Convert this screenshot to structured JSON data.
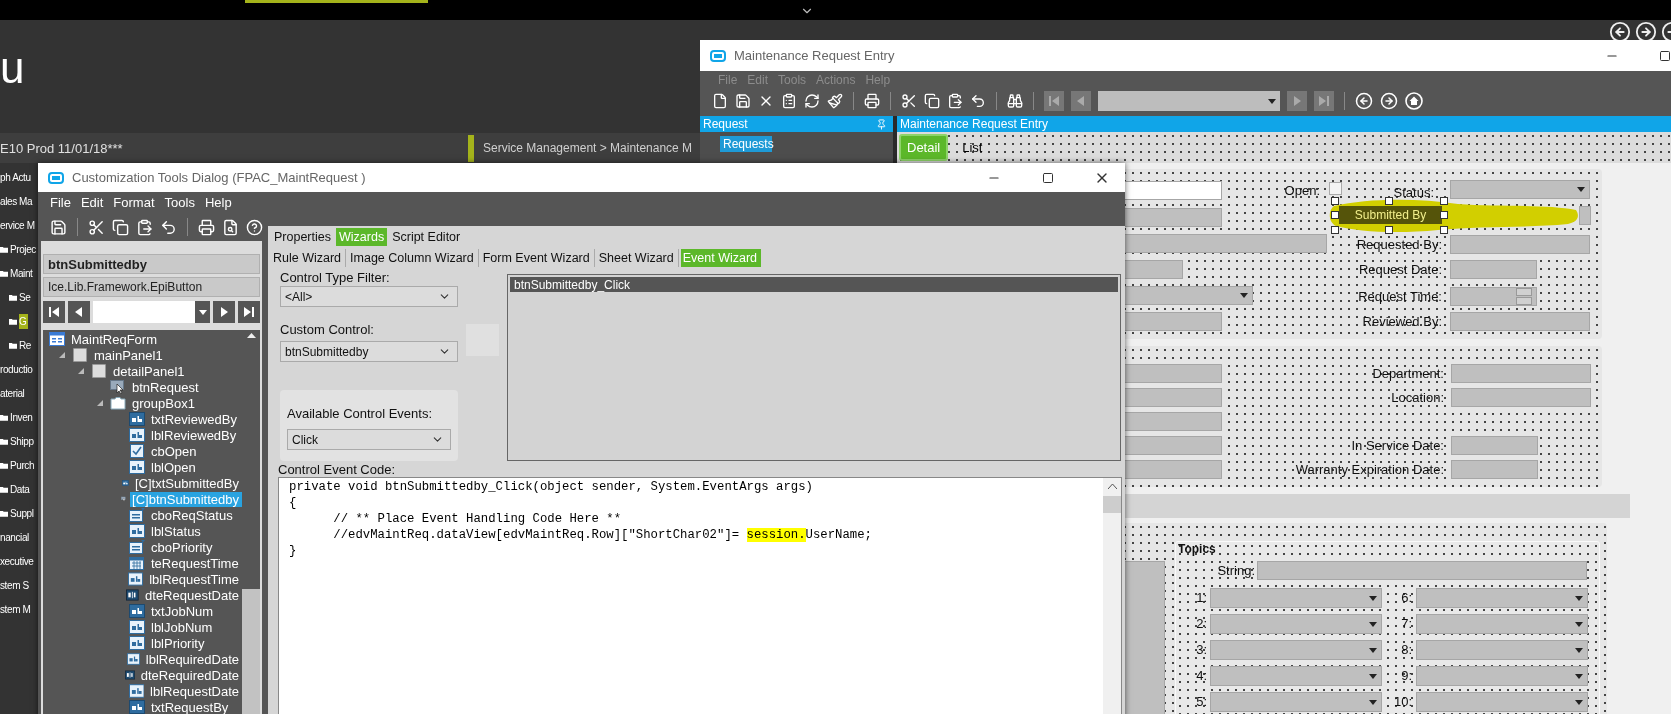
{
  "app": {
    "logo": "u",
    "environment": "E10 Prod  11/01/18***",
    "breadcrumb": "Service Management > Maintenance M",
    "nav": [
      {
        "label": "ph Actu",
        "selected": false
      },
      {
        "label": "ales Ma",
        "selected": false
      },
      {
        "label": "ervice M",
        "selected": false,
        "children": [
          {
            "label": "Projec",
            "selected": false
          },
          {
            "label": "Maint",
            "selected": false,
            "children": [
              {
                "label": "Se",
                "selected": false
              },
              {
                "label": "G",
                "selected": true
              },
              {
                "label": "Re",
                "selected": false
              }
            ]
          }
        ]
      },
      {
        "label": "roductio",
        "selected": false
      },
      {
        "label": "aterial",
        "selected": false,
        "children": [
          {
            "label": "Inven",
            "selected": false
          },
          {
            "label": "Shipp",
            "selected": false
          },
          {
            "label": "Purch",
            "selected": false
          },
          {
            "label": "Data",
            "selected": false
          },
          {
            "label": "Suppl",
            "selected": false
          }
        ]
      },
      {
        "label": "nancial",
        "selected": false
      },
      {
        "label": "xecutive",
        "selected": false
      },
      {
        "label": "stem S",
        "selected": false
      },
      {
        "label": "stem M",
        "selected": false
      }
    ]
  },
  "maintenance_window": {
    "title": "Maintenance Request Entry",
    "menu": [
      {
        "label": "File",
        "disabled": true
      },
      {
        "label": "Edit",
        "disabled": true
      },
      {
        "label": "Tools",
        "disabled": true
      },
      {
        "label": "Actions",
        "disabled": true
      },
      {
        "label": "Help",
        "disabled": true
      }
    ],
    "side_panel": {
      "title": "Request",
      "items": [
        {
          "label": "Requests",
          "selected": true
        }
      ]
    },
    "content_title": "Maintenance Request Entry",
    "form_tabs": [
      {
        "label": "Detail",
        "selected": true
      },
      {
        "label": "List",
        "selected": false
      }
    ],
    "header_panel": {
      "open": {
        "label": "Open:",
        "checked": false
      },
      "status_label": "Status:",
      "submitted_button": {
        "label": "Submitted By",
        "selected": true
      },
      "rows": [
        {
          "label": "Requested By:",
          "kind": "text"
        },
        {
          "label": "Request Date:",
          "kind": "date"
        },
        {
          "label": "Request Time:",
          "kind": "time"
        },
        {
          "label": "Reviewed By:",
          "kind": "text"
        }
      ]
    },
    "location_panel": {
      "rows": [
        {
          "label": "Department:",
          "kind": "text"
        },
        {
          "label": "Location:",
          "kind": "text"
        },
        {
          "label": "In Service Date:",
          "kind": "date"
        },
        {
          "label": "Warranty Expiration Date:",
          "kind": "date"
        }
      ]
    },
    "topics": {
      "title": "Topics",
      "string_label": "String:",
      "slots": [
        "1:",
        "2:",
        "3:",
        "4:",
        "5:",
        "6:",
        "7:",
        "8:",
        "9:",
        "10:"
      ]
    }
  },
  "customization_dialog": {
    "title": "Customization Tools Dialog  (FPAC_MaintRequest )",
    "menu": [
      "File",
      "Edit",
      "Format",
      "Tools",
      "Help"
    ],
    "control_name": "btnSubmittedby",
    "control_type": "Ice.Lib.Framework.EpiButton",
    "tree": [
      {
        "label": "MaintReqForm",
        "kind": "form",
        "selected": false,
        "children": [
          {
            "label": "mainPanel1",
            "kind": "panel",
            "selected": false,
            "expanded": true,
            "children": [
              {
                "label": "detailPanel1",
                "kind": "panel",
                "selected": false,
                "expanded": true,
                "children": [
                  {
                    "label": "btnRequest",
                    "kind": "button",
                    "selected": false
                  },
                  {
                    "label": "groupBox1",
                    "kind": "group",
                    "selected": false,
                    "expanded": true,
                    "children": [
                      {
                        "label": "txtReviewedBy",
                        "kind": "textbox",
                        "selected": false
                      },
                      {
                        "label": "lblReviewedBy",
                        "kind": "label",
                        "selected": false
                      },
                      {
                        "label": "cbOpen",
                        "kind": "checkbox",
                        "selected": false
                      },
                      {
                        "label": "lblOpen",
                        "kind": "label",
                        "selected": false
                      },
                      {
                        "label": "[C]txtSubmittedBy",
                        "kind": "textbox",
                        "selected": false
                      },
                      {
                        "label": "[C]btnSubmittedby",
                        "kind": "button",
                        "selected": true
                      },
                      {
                        "label": "cboReqStatus",
                        "kind": "combo",
                        "selected": false
                      },
                      {
                        "label": "lblStatus",
                        "kind": "label",
                        "selected": false
                      },
                      {
                        "label": "cboPriority",
                        "kind": "combo",
                        "selected": false
                      },
                      {
                        "label": "teRequestTime",
                        "kind": "time",
                        "selected": false
                      },
                      {
                        "label": "lblRequestTime",
                        "kind": "label",
                        "selected": false
                      },
                      {
                        "label": "dteRequestDate",
                        "kind": "date",
                        "selected": false
                      },
                      {
                        "label": "txtJobNum",
                        "kind": "textbox",
                        "selected": false
                      },
                      {
                        "label": "lblJobNum",
                        "kind": "label",
                        "selected": false
                      },
                      {
                        "label": "lblPriority",
                        "kind": "label",
                        "selected": false
                      },
                      {
                        "label": "lblRequiredDate",
                        "kind": "label",
                        "selected": false
                      },
                      {
                        "label": "dteRequiredDate",
                        "kind": "date",
                        "selected": false
                      },
                      {
                        "label": "lblRequestDate",
                        "kind": "label",
                        "selected": false
                      },
                      {
                        "label": "txtRequestBy",
                        "kind": "textbox",
                        "selected": false
                      }
                    ]
                  }
                ]
              }
            ]
          }
        ]
      }
    ],
    "tabs": [
      {
        "label": "Properties",
        "selected": false
      },
      {
        "label": "Wizards",
        "selected": true
      },
      {
        "label": "Script Editor",
        "selected": false
      }
    ],
    "wizard_tabs": [
      {
        "label": "Rule Wizard",
        "selected": false
      },
      {
        "label": "Image Column Wizard",
        "selected": false
      },
      {
        "label": "Form Event Wizard",
        "selected": false
      },
      {
        "label": "Sheet Wizard",
        "selected": false
      },
      {
        "label": "Event Wizard",
        "selected": true
      }
    ],
    "control_type_filter": {
      "label": "Control Type Filter:",
      "value": "<All>"
    },
    "custom_control": {
      "label": "Custom Control:",
      "value": "btnSubmittedby"
    },
    "available_events": {
      "label": "Available Control Events:",
      "value": "Click"
    },
    "event_list": [
      {
        "label": "btnSubmittedby_Click",
        "selected": true
      }
    ],
    "code": {
      "label": "Control Event Code:",
      "lines": [
        [
          {
            "text": "private void btnSubmittedby_Click(object sender, System.EventArgs args)",
            "highlighted": false
          }
        ],
        [
          {
            "text": "{",
            "highlighted": false
          }
        ],
        [
          {
            "text": "      // ** Place Event Handling Code Here **",
            "highlighted": false
          }
        ],
        [
          {
            "text": "      //edvMaintReq.dataView[edvMaintReq.Row][\"ShortChar02\"]= ",
            "highlighted": false
          },
          {
            "text": "session.",
            "highlighted": true
          },
          {
            "text": "UserName;",
            "highlighted": false
          }
        ],
        [
          {
            "text": "}",
            "highlighted": false
          }
        ]
      ]
    }
  }
}
